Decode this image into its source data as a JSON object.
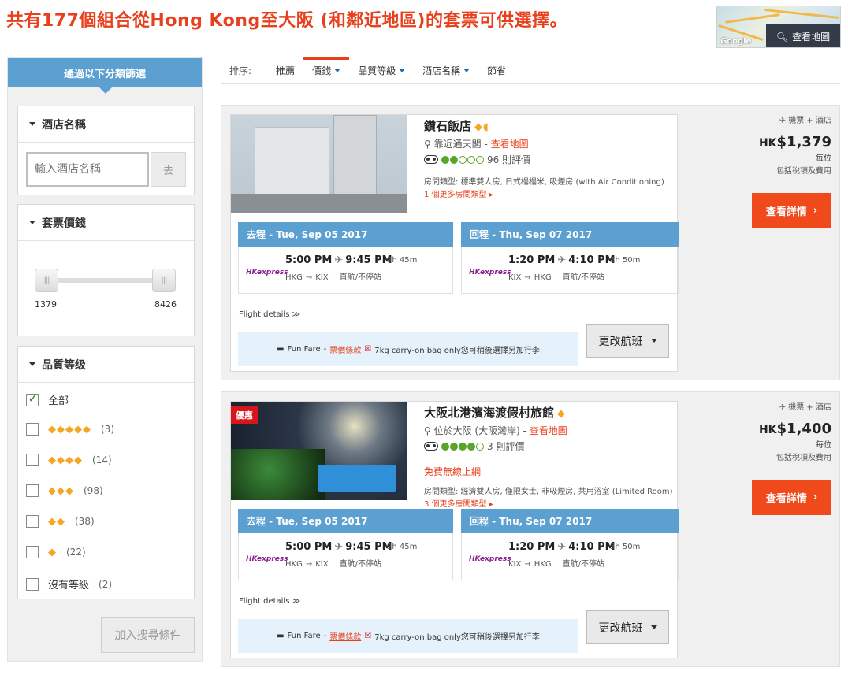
{
  "header": {
    "title": "共有177個組合從Hong Kong至大阪 (和鄰近地區)的套票可供選擇。",
    "map_button": "查看地圖",
    "map_brand": "Google"
  },
  "sidebar": {
    "heading": "通過以下分類篩選",
    "hotel_filter": {
      "title": "酒店名稱",
      "placeholder": "輸入酒店名稱",
      "go_label": "去"
    },
    "price_filter": {
      "title": "套票價錢",
      "min": "1379",
      "max": "8426"
    },
    "rating_filter": {
      "title": "品質等级",
      "options": [
        {
          "label": "全部",
          "diamonds": "",
          "count": "",
          "checked": true
        },
        {
          "label": "",
          "diamonds": "◆◆◆◆◆",
          "count": "(3)",
          "checked": false
        },
        {
          "label": "",
          "diamonds": "◆◆◆◆",
          "count": "(14)",
          "checked": false
        },
        {
          "label": "",
          "diamonds": "◆◆◆",
          "count": "(98)",
          "checked": false
        },
        {
          "label": "",
          "diamonds": "◆◆",
          "count": "(38)",
          "checked": false
        },
        {
          "label": "",
          "diamonds": "◆",
          "count": "(22)",
          "checked": false
        },
        {
          "label": "沒有等級",
          "diamonds": "",
          "count": "(2)",
          "checked": false
        }
      ]
    },
    "add_search": "加入搜尋條件"
  },
  "sort": {
    "label": "排序:",
    "items": [
      {
        "label": "推薦",
        "active": false,
        "caret": false
      },
      {
        "label": "價錢",
        "active": true,
        "caret": true
      },
      {
        "label": "品質等級",
        "active": false,
        "caret": true
      },
      {
        "label": "酒店名稱",
        "active": false,
        "caret": true
      },
      {
        "label": "節省",
        "active": false,
        "caret": false
      }
    ]
  },
  "packages": [
    {
      "hotel_name": "鑽石飯店",
      "diamonds": "◆◖",
      "location": "靠近通天閣",
      "map_link": "查看地圖",
      "reviews": "96 則評價",
      "rating_dots": [
        1,
        1,
        0,
        0,
        0
      ],
      "wifi": "",
      "badge": "",
      "room_type": "房間類型: 標準雙人房, 日式榻榻米, 吸煙房 (with Air Conditioning)",
      "more_rooms": "1 個更多房間類型 ▸",
      "outbound": {
        "header": "去程 - Tue, Sep 05 2017",
        "airline": "HKexpress",
        "depart": "5:00 PM",
        "arrive": "9:45 PM",
        "duration": "3h 45m",
        "from": "HKG",
        "to": "KIX",
        "stops": "直航/不停站"
      },
      "inbound": {
        "header": "回程 - Thu, Sep 07 2017",
        "airline": "HKexpress",
        "depart": "1:20 PM",
        "arrive": "4:10 PM",
        "duration": "3h 50m",
        "from": "KIX",
        "to": "HKG",
        "stops": "直航/不停站"
      },
      "flight_details": "Flight details ≫",
      "fare_name": "Fun Fare",
      "fare_terms": "票價條款",
      "bag_note": "7kg carry-on bag only您可稍後選擇另加行李",
      "change_flight": "更改航班",
      "package_label": "機票 + 酒店",
      "currency": "HK",
      "price": "$1,379",
      "per_person": "每位",
      "tax_note": "包括稅項及費用",
      "detail_button": "查看詳情"
    },
    {
      "hotel_name": "大阪北港濱海渡假村旅館",
      "diamonds": "◆",
      "location": "位於大阪 (大阪灣岸)",
      "map_link": "查看地圖",
      "reviews": "3 則評價",
      "rating_dots": [
        1,
        1,
        1,
        1,
        0
      ],
      "wifi": "免費無線上網",
      "badge": "優惠",
      "room_type": "房間類型: 經濟雙人房, 僅限女士, 非吸煙房, 共用浴室 (Limited Room)",
      "more_rooms": "3 個更多房間類型 ▸",
      "outbound": {
        "header": "去程 - Tue, Sep 05 2017",
        "airline": "HKexpress",
        "depart": "5:00 PM",
        "arrive": "9:45 PM",
        "duration": "3h 45m",
        "from": "HKG",
        "to": "KIX",
        "stops": "直航/不停站"
      },
      "inbound": {
        "header": "回程 - Thu, Sep 07 2017",
        "airline": "HKexpress",
        "depart": "1:20 PM",
        "arrive": "4:10 PM",
        "duration": "3h 50m",
        "from": "KIX",
        "to": "HKG",
        "stops": "直航/不停站"
      },
      "flight_details": "Flight details ≫",
      "fare_name": "Fun Fare",
      "fare_terms": "票價條款",
      "bag_note": "7kg carry-on bag only您可稍後選擇另加行李",
      "change_flight": "更改航班",
      "package_label": "機票 + 酒店",
      "currency": "HK",
      "price": "$1,400",
      "per_person": "每位",
      "tax_note": "包括稅項及費用",
      "detail_button": "查看詳情"
    }
  ],
  "colors": {
    "accent": "#e8401c",
    "header_blue": "#5ba0d0",
    "diamond": "#f5a623",
    "review_green": "#58a52b"
  }
}
